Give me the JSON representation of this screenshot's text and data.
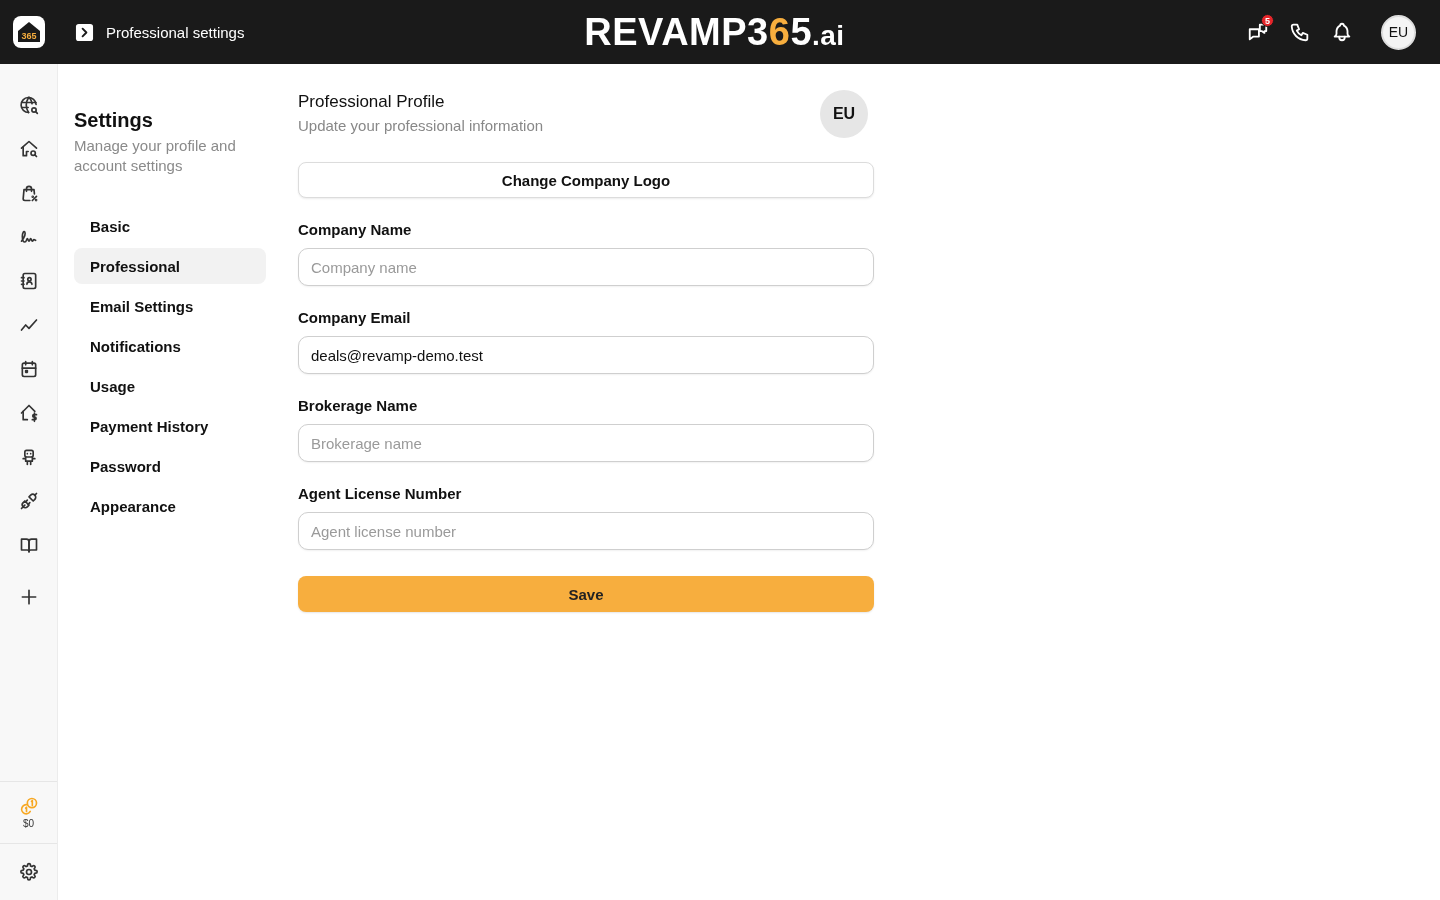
{
  "top_bar": {
    "app_logo": "365",
    "page_title": "Professional settings",
    "brand_logo": [
      {
        "text": "REVAMP",
        "accent": false
      },
      {
        "text": "3",
        "accent": false
      },
      {
        "text": "6",
        "accent": true
      },
      {
        "text": "5",
        "accent": false
      },
      {
        "text": ".ai",
        "accent": false
      }
    ],
    "messages_badge": "5",
    "avatar": "EU"
  },
  "rail": {
    "credits": "$0"
  },
  "settings_nav": {
    "title": "Settings",
    "subtitle": "Manage your profile and account settings",
    "items": [
      {
        "label": "Basic",
        "selected": false
      },
      {
        "label": "Professional",
        "selected": true
      },
      {
        "label": "Email Settings",
        "selected": false
      },
      {
        "label": "Notifications",
        "selected": false
      },
      {
        "label": "Usage",
        "selected": false
      },
      {
        "label": "Payment History",
        "selected": false
      },
      {
        "label": "Password",
        "selected": false
      },
      {
        "label": "Appearance",
        "selected": false
      }
    ]
  },
  "profile": {
    "title": "Professional Profile",
    "subtitle": "Update your professional information",
    "avatar": "EU",
    "logo_button": "Change Company Logo",
    "fields": [
      {
        "label": "Company Name",
        "placeholder": "Company name"
      },
      {
        "label": "Company Email",
        "value": "deals@revamp-demo.test"
      },
      {
        "label": "Brokerage Name",
        "placeholder": "Brokerage name"
      },
      {
        "label": "Agent License Number",
        "placeholder": "Agent license number"
      }
    ],
    "save_button": "Save"
  }
}
